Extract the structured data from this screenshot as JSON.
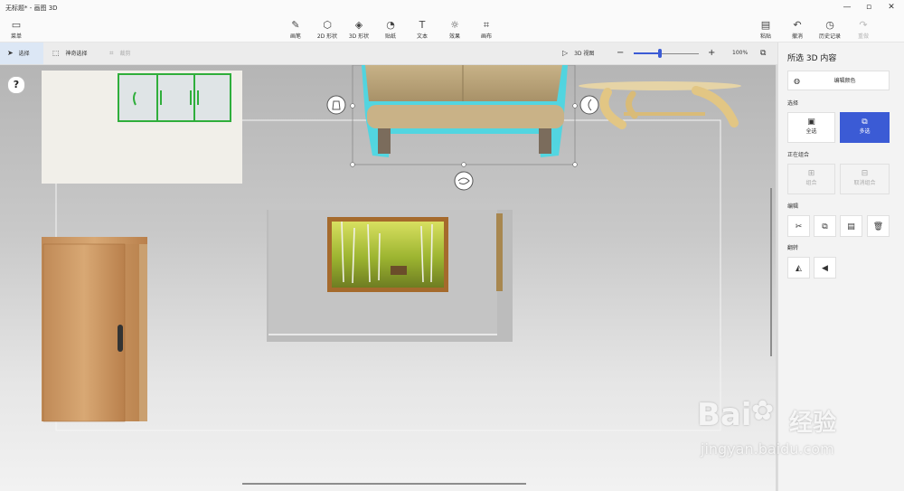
{
  "window": {
    "title": "无标题* - 画图 3D",
    "controls": [
      "—",
      "▫",
      "✕"
    ]
  },
  "toolbar": {
    "menu_label": "菜单",
    "tools": [
      {
        "label": "画笔",
        "icon": "brush-icon"
      },
      {
        "label": "2D 形状",
        "icon": "2d-shapes-icon"
      },
      {
        "label": "3D 形状",
        "icon": "3d-shapes-icon"
      },
      {
        "label": "贴纸",
        "icon": "stickers-icon"
      },
      {
        "label": "文本",
        "icon": "text-icon"
      },
      {
        "label": "效果",
        "icon": "effects-icon"
      },
      {
        "label": "画布",
        "icon": "canvas-icon"
      }
    ],
    "right": [
      {
        "label": "粘贴",
        "icon": "paste-icon"
      },
      {
        "label": "撤消",
        "icon": "undo-icon"
      },
      {
        "label": "历史记录",
        "icon": "history-icon"
      },
      {
        "label": "重做",
        "icon": "redo-icon",
        "disabled": true
      }
    ]
  },
  "secondary_bar": {
    "select_label": "选择",
    "magic_select_label": "神奇选择",
    "crop_label": "裁剪",
    "view_3d_label": "3D 视图",
    "zoom_value": "100%",
    "zoom_fraction": 0.4
  },
  "canvas": {
    "help_label": "?"
  },
  "panel": {
    "title": "所选 3D 内容",
    "edit_color_label": "编辑颜色",
    "select_section": "选择",
    "select_all_label": "全选",
    "multi_select_label": "多选",
    "group_section": "正在组合",
    "group_label": "组合",
    "ungroup_label": "取消组合",
    "edit_section": "编辑",
    "flip_section": "翻转"
  },
  "watermark": {
    "line1": "Bai",
    "line2": "经验",
    "url": "jingyan.baidu.com"
  },
  "colors": {
    "accent": "#3b5bd5",
    "selection_glow": "#3fd9e6",
    "cabinet_green": "#2fae3b"
  }
}
